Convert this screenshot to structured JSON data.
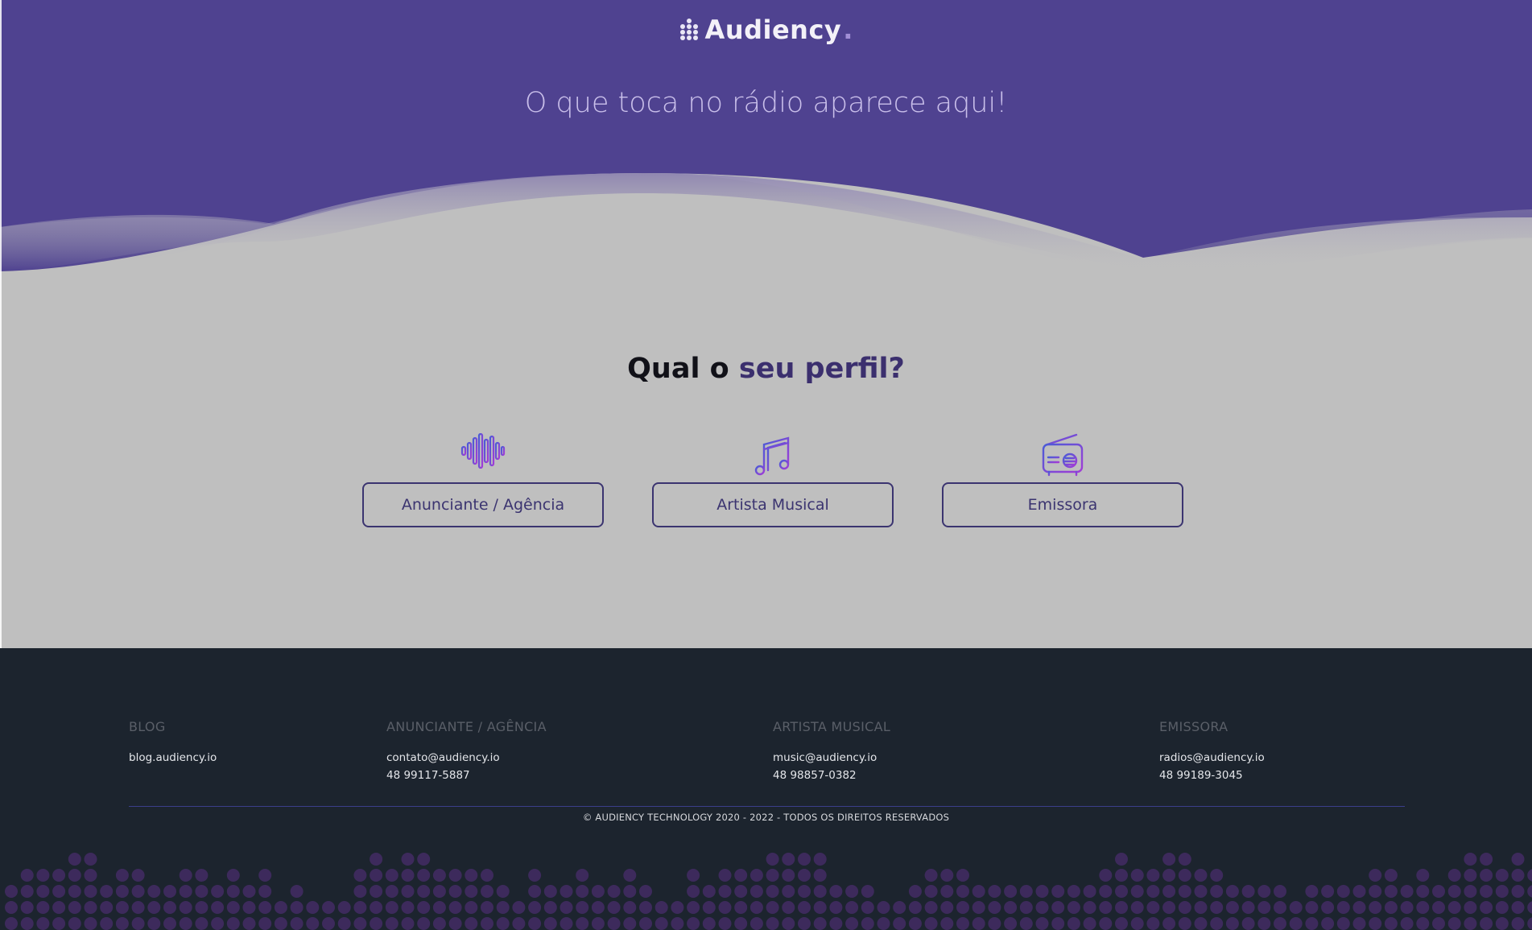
{
  "header": {
    "logo_text": "Audiency",
    "tagline": "O que toca no rádio aparece aqui!"
  },
  "profile": {
    "title_part1": "Qual o",
    "title_part2": "seu perfil?",
    "options": [
      {
        "label": "Anunciante / Agência",
        "icon": "sound-wave-icon"
      },
      {
        "label": "Artista Musical",
        "icon": "music-note-icon"
      },
      {
        "label": "Emissora",
        "icon": "radio-icon"
      }
    ]
  },
  "footer": {
    "columns": [
      {
        "title": "BLOG",
        "lines": [
          "blog.audiency.io"
        ]
      },
      {
        "title": "ANUNCIANTE / AGÊNCIA",
        "lines": [
          "contato@audiency.io",
          "48 99117-5887"
        ]
      },
      {
        "title": "ARTISTA MUSICAL",
        "lines": [
          "music@audiency.io",
          "48 98857-0382"
        ]
      },
      {
        "title": "EMISSORA",
        "lines": [
          "radios@audiency.io",
          "48 99189-3045"
        ]
      }
    ],
    "copyright": "© AUDIENCY TECHNOLOGY 2020 - 2022 - TODOS OS DIREITOS RESERVADOS"
  },
  "colors": {
    "hero": "#4f4290",
    "page_bg": "#bfbfbf",
    "footer_bg": "#1c242e",
    "accent": "#3b3470",
    "equalizer_dots": "#3d2a5c"
  }
}
